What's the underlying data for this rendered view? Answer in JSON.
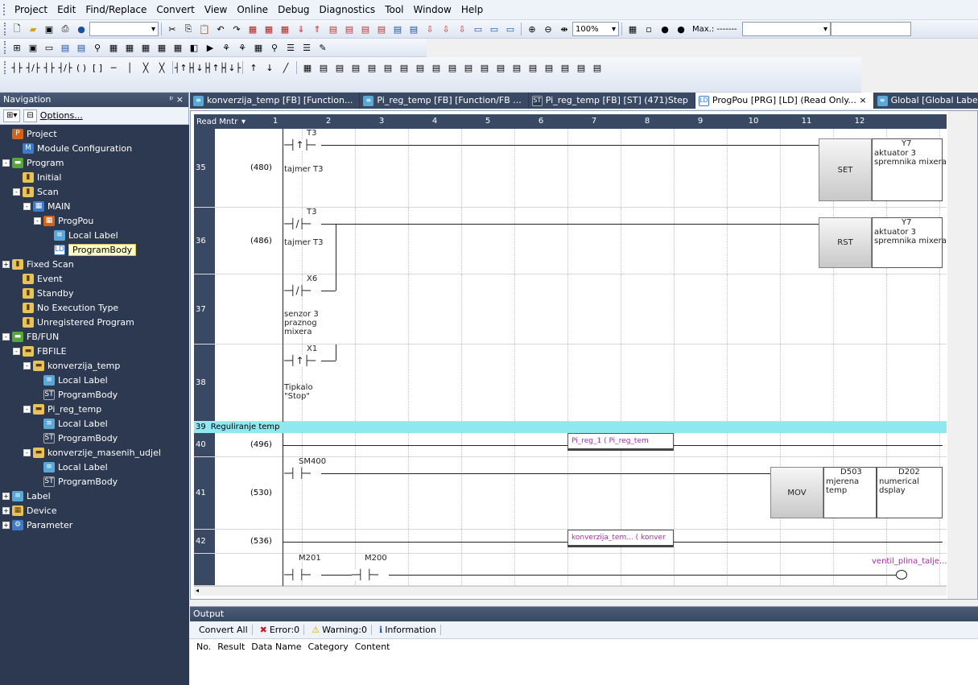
{
  "menu": [
    "Project",
    "Edit",
    "Find/Replace",
    "Convert",
    "View",
    "Online",
    "Debug",
    "Diagnostics",
    "Tool",
    "Window",
    "Help"
  ],
  "toolbar": {
    "zoom": "100%",
    "max_label": "Max.: -------"
  },
  "navigation": {
    "title": "Navigation",
    "pin": "ᵖ ×",
    "options": "Options...",
    "tree": [
      {
        "label": "Project",
        "level": 0,
        "icon": "project-icon",
        "toggle": ""
      },
      {
        "label": "Module Configuration",
        "level": 1,
        "icon": "module-config-icon",
        "toggle": ""
      },
      {
        "label": "Program",
        "level": 0,
        "icon": "program-folder-icon",
        "toggle": "-"
      },
      {
        "label": "Initial",
        "level": 1,
        "icon": "task-icon",
        "toggle": ""
      },
      {
        "label": "Scan",
        "level": 1,
        "icon": "task-icon",
        "toggle": "-"
      },
      {
        "label": "MAIN",
        "level": 2,
        "icon": "program-file-icon",
        "toggle": "-"
      },
      {
        "label": "ProgPou",
        "level": 3,
        "icon": "pou-icon",
        "toggle": "-"
      },
      {
        "label": "Local Label",
        "level": 4,
        "icon": "label-icon",
        "toggle": ""
      },
      {
        "label": "ProgramBody",
        "level": 4,
        "icon": "ld-body-icon",
        "toggle": "",
        "selected": true
      },
      {
        "label": "Fixed Scan",
        "level": 0,
        "icon": "task-icon",
        "toggle": "+"
      },
      {
        "label": "Event",
        "level": 1,
        "icon": "task-icon",
        "toggle": ""
      },
      {
        "label": "Standby",
        "level": 1,
        "icon": "task-icon",
        "toggle": ""
      },
      {
        "label": "No Execution Type",
        "level": 1,
        "icon": "task-icon",
        "toggle": ""
      },
      {
        "label": "Unregistered Program",
        "level": 1,
        "icon": "unregistered-icon",
        "toggle": ""
      },
      {
        "label": "FB/FUN",
        "level": 0,
        "icon": "fb-folder-icon",
        "toggle": "-"
      },
      {
        "label": "FBFILE",
        "level": 1,
        "icon": "folder-icon",
        "toggle": "-"
      },
      {
        "label": "konverzija_temp",
        "level": 2,
        "icon": "folder-icon",
        "toggle": "-"
      },
      {
        "label": "Local Label",
        "level": 3,
        "icon": "label-icon",
        "toggle": ""
      },
      {
        "label": "ProgramBody",
        "level": 3,
        "icon": "st-body-icon",
        "toggle": ""
      },
      {
        "label": "Pi_reg_temp",
        "level": 2,
        "icon": "folder-icon",
        "toggle": "-"
      },
      {
        "label": "Local Label",
        "level": 3,
        "icon": "label-icon",
        "toggle": ""
      },
      {
        "label": "ProgramBody",
        "level": 3,
        "icon": "st-body-icon",
        "toggle": ""
      },
      {
        "label": "konverzije_masenih_udjel",
        "level": 2,
        "icon": "folder-icon",
        "toggle": "-"
      },
      {
        "label": "Local Label",
        "level": 3,
        "icon": "label-icon",
        "toggle": ""
      },
      {
        "label": "ProgramBody",
        "level": 3,
        "icon": "st-body-icon",
        "toggle": ""
      },
      {
        "label": "Label",
        "level": 0,
        "icon": "label-icon",
        "toggle": "+"
      },
      {
        "label": "Device",
        "level": 0,
        "icon": "device-icon",
        "toggle": "+"
      },
      {
        "label": "Parameter",
        "level": 0,
        "icon": "parameter-icon",
        "toggle": "+"
      }
    ]
  },
  "tabs": [
    {
      "label": "konverzija_temp [FB] [Function...",
      "icon": "label-icon",
      "active": false
    },
    {
      "label": "Pi_reg_temp [FB] [Function/FB ...",
      "icon": "label-icon",
      "active": false
    },
    {
      "label": "Pi_reg_temp [FB] [ST] (471)Step",
      "icon": "st-body-icon",
      "active": false
    },
    {
      "label": "ProgPou [PRG] [LD] (Read Only... ×",
      "icon": "ld-body-icon",
      "active": true
    },
    {
      "label": "Global [Global Label Setti",
      "icon": "label-icon",
      "active": false
    }
  ],
  "ladder": {
    "monitor_label": "Read Mntr",
    "columns": [
      "1",
      "2",
      "3",
      "4",
      "5",
      "6",
      "7",
      "8",
      "9",
      "10",
      "11",
      "12"
    ],
    "rows": [
      {
        "num": "35",
        "step": "(480)",
        "device": "T3",
        "comment": "tajmer T3",
        "instr": "SET",
        "out_dev": "Y7",
        "out_cmt": "aktuator 3\nspremnika mixera"
      },
      {
        "num": "36",
        "step": "(486)",
        "device": "T3",
        "comment": "tajmer T3",
        "instr": "RST",
        "out_dev": "Y7",
        "out_cmt": "aktuator 3\nspremnika mixera"
      },
      {
        "num": "37",
        "step": "",
        "device": "X6",
        "comment": "senzor 3\npraznog\nmixera"
      },
      {
        "num": "38",
        "step": "",
        "device": "X1",
        "comment": "Tipkalo\n\"Stop\""
      },
      {
        "num": "39",
        "comment": "Reguliranje temp"
      },
      {
        "num": "40",
        "step": "(496)",
        "fb": "Pi_reg_1     ( Pi_reg_tem"
      },
      {
        "num": "41",
        "step": "(530)",
        "device": "SM400",
        "instr": "MOV",
        "s_dev": "D503",
        "s_cmt": "mjerena\ntemp",
        "d_dev": "D202",
        "d_cmt": "numerical dsplay"
      },
      {
        "num": "42",
        "step": "(536)",
        "fb": "konverzija_tem...  ( konver"
      },
      {
        "num": "",
        "device1": "M201",
        "device2": "M200",
        "coil": "ventil_plina_talje..."
      }
    ]
  },
  "output": {
    "title": "Output",
    "convert_all": "Convert All",
    "error": "Error:0",
    "warning": "Warning:0",
    "information": "Information",
    "columns": [
      "No.",
      "Result",
      "Data Name",
      "Category",
      "Content"
    ]
  }
}
